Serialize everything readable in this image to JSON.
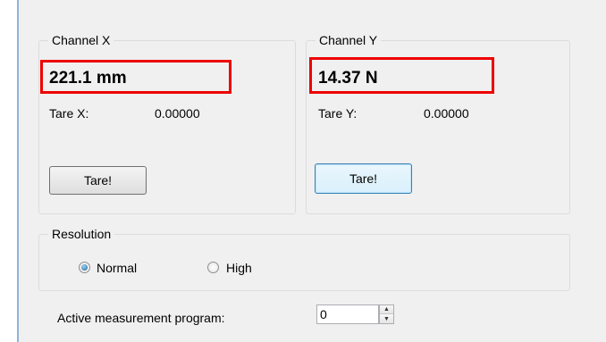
{
  "channel_x": {
    "legend": "Channel X",
    "reading": "221.1 mm",
    "tare_label": "Tare X:",
    "tare_value": "0.00000",
    "tare_button": "Tare!"
  },
  "channel_y": {
    "legend": "Channel Y",
    "reading": "14.37 N",
    "tare_label": "Tare Y:",
    "tare_value": "0.00000",
    "tare_button": "Tare!"
  },
  "resolution": {
    "legend": "Resolution",
    "options": [
      {
        "label": "Normal",
        "selected": true
      },
      {
        "label": "High",
        "selected": false
      }
    ]
  },
  "program": {
    "label": "Active measurement program:",
    "value": "0"
  },
  "colors": {
    "highlight_box": "#ee0000",
    "left_accent": "#8fb3d9"
  },
  "icons": [
    "spin-up-icon",
    "spin-down-icon",
    "radio-selected-icon",
    "radio-unselected-icon"
  ]
}
